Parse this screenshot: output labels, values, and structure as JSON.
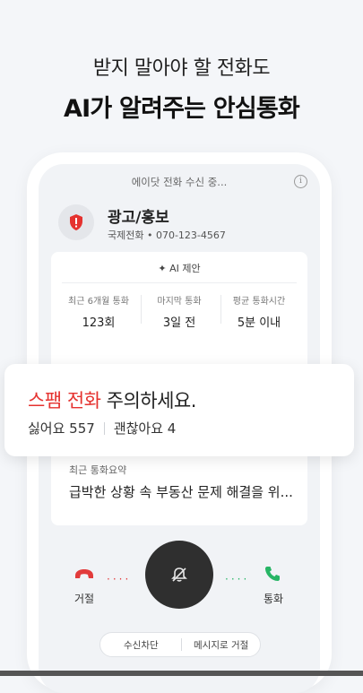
{
  "headline": {
    "line1": "받지 말아야 할 전화도",
    "line2": "AI가 알려주는 안심통화"
  },
  "phone": {
    "status": "에이닷 전화 수신 중...",
    "info_icon": "info-icon",
    "caller": {
      "name": "광고/홍보",
      "subtitle": "국제전화 • 070-123-4567",
      "badge_icon": "shield-alert-icon",
      "badge_color": "#e5322f"
    },
    "ai_card": {
      "title": "✦ AI 제안",
      "stats": [
        {
          "label": "최근 6개월 통화",
          "value": "123회"
        },
        {
          "label": "마지막 통화",
          "value": "3일 전"
        },
        {
          "label": "평균 통화시간",
          "value": "5분 이내"
        }
      ]
    },
    "summary": {
      "label": "최근 통화요약",
      "text": "급박한 상황 속 부동산 문제 해결을 위..."
    },
    "actions": {
      "reject_label": "거절",
      "accept_label": "통화",
      "reject_color": "#e23b3b",
      "accept_color": "#27b565",
      "center_icon": "mute-bell-icon"
    },
    "bottom_pill": {
      "block_label": "수신차단",
      "message_label": "메시지로 거절"
    }
  },
  "alert": {
    "title_red": "스팸 전화",
    "title_rest": " 주의하세요.",
    "dislike": "싫어요 557",
    "ok": "괜찮아요 4"
  }
}
